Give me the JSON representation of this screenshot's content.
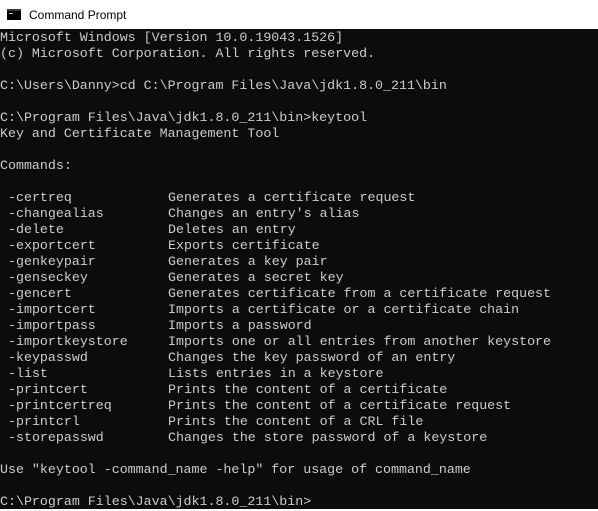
{
  "window": {
    "title": "Command Prompt",
    "icon": "cmd-console-icon"
  },
  "header_lines": [
    "Microsoft Windows [Version 10.0.19043.1526]",
    "(c) Microsoft Corporation. All rights reserved.",
    "",
    "C:\\Users\\Danny>cd C:\\Program Files\\Java\\jdk1.8.0_211\\bin",
    "",
    "C:\\Program Files\\Java\\jdk1.8.0_211\\bin>keytool",
    "Key and Certificate Management Tool",
    "",
    "Commands:",
    ""
  ],
  "commands": [
    {
      "name": "-certreq",
      "description": "Generates a certificate request"
    },
    {
      "name": "-changealias",
      "description": "Changes an entry's alias"
    },
    {
      "name": "-delete",
      "description": "Deletes an entry"
    },
    {
      "name": "-exportcert",
      "description": "Exports certificate"
    },
    {
      "name": "-genkeypair",
      "description": "Generates a key pair"
    },
    {
      "name": "-genseckey",
      "description": "Generates a secret key"
    },
    {
      "name": "-gencert",
      "description": "Generates certificate from a certificate request"
    },
    {
      "name": "-importcert",
      "description": "Imports a certificate or a certificate chain"
    },
    {
      "name": "-importpass",
      "description": "Imports a password"
    },
    {
      "name": "-importkeystore",
      "description": "Imports one or all entries from another keystore"
    },
    {
      "name": "-keypasswd",
      "description": "Changes the key password of an entry"
    },
    {
      "name": "-list",
      "description": "Lists entries in a keystore"
    },
    {
      "name": "-printcert",
      "description": "Prints the content of a certificate"
    },
    {
      "name": "-printcertreq",
      "description": "Prints the content of a certificate request"
    },
    {
      "name": "-printcrl",
      "description": "Prints the content of a CRL file"
    },
    {
      "name": "-storepasswd",
      "description": "Changes the store password of a keystore"
    }
  ],
  "footer_lines": [
    "",
    "Use \"keytool -command_name -help\" for usage of command_name",
    "",
    "C:\\Program Files\\Java\\jdk1.8.0_211\\bin>"
  ],
  "colors": {
    "console_background": "#0c0c0c",
    "console_text": "#cccccc",
    "titlebar_background": "#ffffff"
  }
}
